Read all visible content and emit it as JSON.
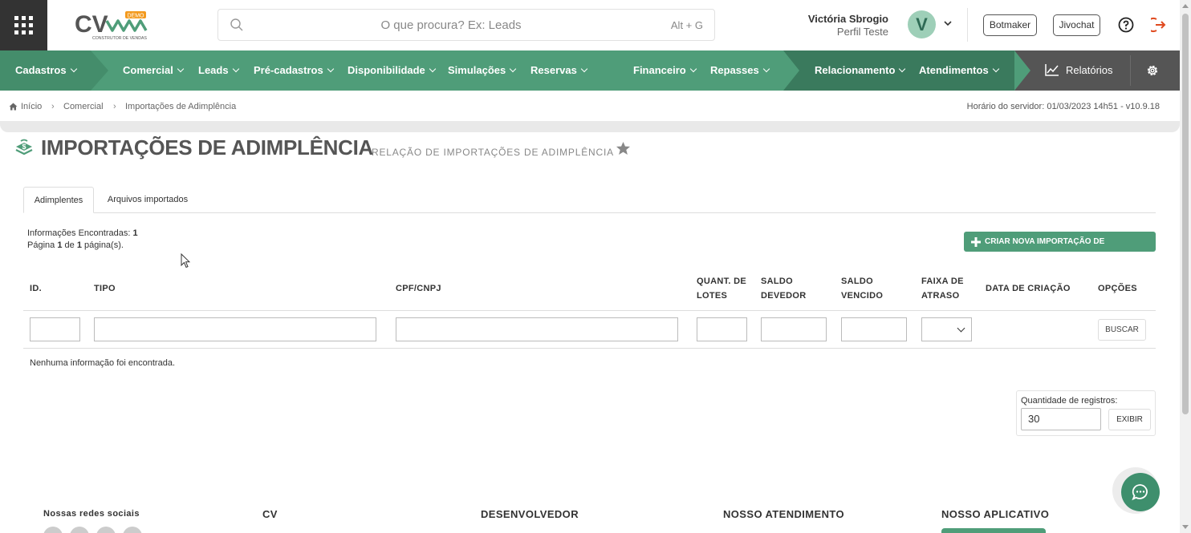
{
  "header": {
    "logo_text": "CV",
    "logo_badge": "DEMO",
    "logo_tagline": "CONSTRUTOR DE VENDAS",
    "search_placeholder": "O que procura? Ex: Leads",
    "search_shortcut": "Alt + G",
    "user_name": "Victória Sbrogio",
    "user_profile": "Perfil Teste",
    "avatar_letter": "V",
    "botmaker_label": "Botmaker",
    "jivochat_label": "Jivochat"
  },
  "nav": {
    "items": [
      {
        "label": "Cadastros"
      },
      {
        "label": "Comercial"
      },
      {
        "label": "Leads"
      },
      {
        "label": "Pré-cadastros"
      },
      {
        "label": "Disponibilidade"
      },
      {
        "label": "Simulações"
      },
      {
        "label": "Reservas"
      },
      {
        "label": "Financeiro"
      },
      {
        "label": "Repasses"
      },
      {
        "label": "Relacionamento"
      },
      {
        "label": "Atendimentos"
      }
    ],
    "reports_label": "Relatórios"
  },
  "breadcrumb": {
    "items": [
      "Início",
      "Comercial",
      "Importações de Adimplência"
    ],
    "server_time": "Horário do servidor: 01/03/2023 14h51 - v10.9.18"
  },
  "page": {
    "title": "IMPORTAÇÕES DE ADIMPLÊNCIA",
    "subtitle": "RELAÇÃO DE IMPORTAÇÕES DE ADIMPLÊNCIA"
  },
  "tabs": [
    {
      "label": "Adimplentes",
      "active": true
    },
    {
      "label": "Arquivos importados",
      "active": false
    }
  ],
  "results": {
    "found_label": "Informações Encontradas:",
    "found_count": "1",
    "page_prefix": "Página",
    "page_current": "1",
    "page_of": "de",
    "page_total": "1",
    "page_suffix": "página(s)."
  },
  "new_button_label": "CRIAR NOVA IMPORTAÇÃO DE ADIMPLÊNCIA",
  "table": {
    "columns": [
      {
        "label": "ID."
      },
      {
        "label": "TIPO"
      },
      {
        "label": "CPF/CNPJ"
      },
      {
        "label": "QUANT. DE LOTES"
      },
      {
        "label": "SALDO DEVEDOR"
      },
      {
        "label": "SALDO VENCIDO"
      },
      {
        "label": "FAIXA DE ATRASO"
      },
      {
        "label": "DATA DE CRIAÇÃO"
      },
      {
        "label": "OPÇÕES"
      }
    ],
    "search_button": "BUSCAR",
    "empty_message": "Nenhuma informação foi encontrada."
  },
  "records": {
    "label": "Quantidade de registros:",
    "value": "30",
    "button": "EXIBIR"
  },
  "footer": {
    "social_title": "Nossas redes sociais",
    "col_cv": "CV",
    "col_dev": "DESENVOLVEDOR",
    "col_support": "NOSSO ATENDIMENTO",
    "col_app": "NOSSO APLICATIVO"
  },
  "colors": {
    "brand_green": "#4f9d79",
    "nav_dark_green": "#3a7a5d",
    "nav_gray": "#555555",
    "logout_red": "#e04a1f"
  }
}
